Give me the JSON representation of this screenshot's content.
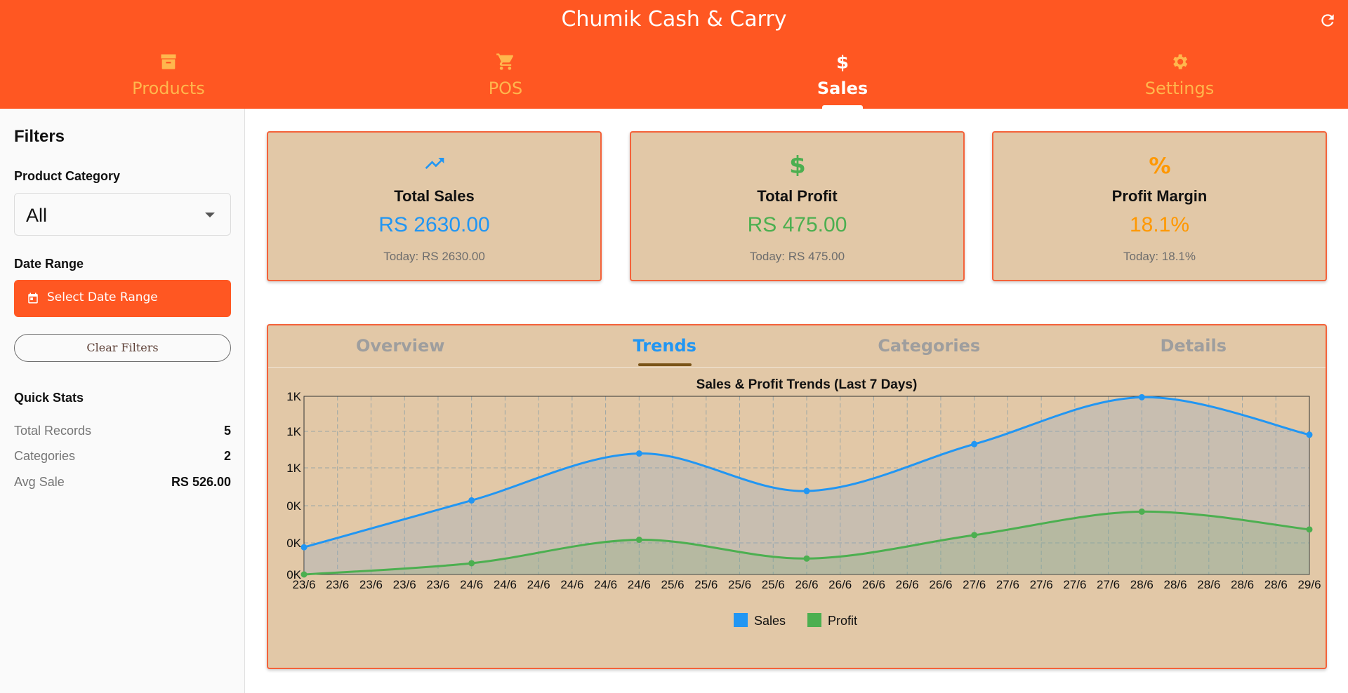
{
  "header": {
    "title": "Chumik Cash & Carry",
    "nav": [
      {
        "label": "Products",
        "icon": "archive-icon"
      },
      {
        "label": "POS",
        "icon": "cart-icon"
      },
      {
        "label": "Sales",
        "icon": "dollar-icon",
        "active": true
      },
      {
        "label": "Settings",
        "icon": "gear-icon"
      }
    ]
  },
  "sidebar": {
    "title": "Filters",
    "category_label": "Product Category",
    "category_value": "All",
    "date_label": "Date Range",
    "date_button": "Select Date Range",
    "clear_button": "Clear Filters",
    "quick_stats_title": "Quick Stats",
    "stats": [
      {
        "key": "Total Records",
        "value": "5"
      },
      {
        "key": "Categories",
        "value": "2"
      },
      {
        "key": "Avg Sale",
        "value": "RS 526.00"
      }
    ]
  },
  "cards": [
    {
      "title": "Total Sales",
      "value": "RS 2630.00",
      "sub": "Today: RS 2630.00",
      "icon": "trending-up-icon",
      "color": "#2196f3"
    },
    {
      "title": "Total Profit",
      "value": "RS 475.00",
      "sub": "Today: RS 475.00",
      "icon": "dollar-icon",
      "color": "#4caf50"
    },
    {
      "title": "Profit Margin",
      "value": "18.1%",
      "sub": "Today: 18.1%",
      "icon": "percent-icon",
      "color": "#ff9800"
    }
  ],
  "tabs": [
    {
      "label": "Overview"
    },
    {
      "label": "Trends",
      "active": true
    },
    {
      "label": "Categories"
    },
    {
      "label": "Details"
    }
  ],
  "colors": {
    "accent": "#ff5722",
    "sales": "#2196f3",
    "profit": "#4caf50",
    "panel": "#e2c8a7"
  },
  "chart_data": {
    "type": "line",
    "title": "Sales & Profit Trends (Last 7 Days)",
    "x": [
      "23/6",
      "24/6",
      "25/6",
      "26/6",
      "27/6",
      "28/6",
      "29/6"
    ],
    "x_tick_labels": [
      "23/6",
      "23/6",
      "23/6",
      "23/6",
      "23/6",
      "24/6",
      "24/6",
      "24/6",
      "24/6",
      "24/6",
      "24/6",
      "25/6",
      "25/6",
      "25/6",
      "25/6",
      "26/6",
      "26/6",
      "26/6",
      "26/6",
      "26/6",
      "27/6",
      "27/6",
      "27/6",
      "27/6",
      "27/6",
      "28/6",
      "28/6",
      "28/6",
      "28/6",
      "28/6",
      "29/6"
    ],
    "y_tick_labels": [
      "0K",
      "0K",
      "0K",
      "1K",
      "1K",
      "1K"
    ],
    "ylim": [
      0,
      950
    ],
    "series": [
      {
        "name": "Sales",
        "values": [
          145,
          395,
          645,
          445,
          695,
          945,
          745
        ]
      },
      {
        "name": "Profit",
        "values": [
          0,
          60,
          185,
          85,
          210,
          335,
          240
        ]
      }
    ],
    "legend": "bottom-center",
    "grid": true,
    "area_fill": true
  }
}
